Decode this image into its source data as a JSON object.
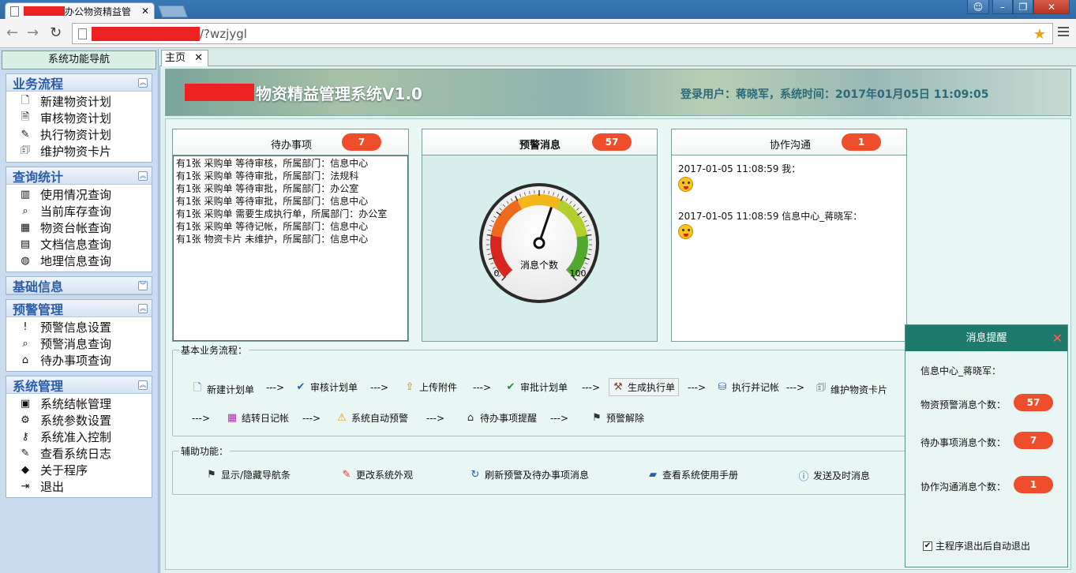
{
  "browser": {
    "tab_title": "办公物资精益管",
    "url_suffix": "/?wzjygl"
  },
  "sidebar": {
    "header": "系统功能导航",
    "sections": [
      {
        "title": "业务流程",
        "toggle": "︽",
        "items": [
          {
            "label": "新建物资计划",
            "icon": "🗋"
          },
          {
            "label": "审核物资计划",
            "icon": "🗎"
          },
          {
            "label": "执行物资计划",
            "icon": "✎"
          },
          {
            "label": "维护物资卡片",
            "icon": "🗊"
          }
        ]
      },
      {
        "title": "查询统计",
        "toggle": "︽",
        "items": [
          {
            "label": "使用情况查询",
            "icon": "▥"
          },
          {
            "label": "当前库存查询",
            "icon": "⌕"
          },
          {
            "label": "物资台帐查询",
            "icon": "▦"
          },
          {
            "label": "文档信息查询",
            "icon": "▤"
          },
          {
            "label": "地理信息查询",
            "icon": "◍"
          }
        ]
      },
      {
        "title": "基础信息",
        "toggle": "︾",
        "items": []
      },
      {
        "title": "预警管理",
        "toggle": "︽",
        "items": [
          {
            "label": "预警信息设置",
            "icon": "!"
          },
          {
            "label": "预警消息查询",
            "icon": "⌕"
          },
          {
            "label": "待办事项查询",
            "icon": "⌂"
          }
        ]
      },
      {
        "title": "系统管理",
        "toggle": "︽",
        "items": [
          {
            "label": "系统结帐管理",
            "icon": "▣"
          },
          {
            "label": "系统参数设置",
            "icon": "⚙"
          },
          {
            "label": "系统准入控制",
            "icon": "⚷"
          },
          {
            "label": "查看系统日志",
            "icon": "✎"
          },
          {
            "label": "关于程序",
            "icon": "◆"
          },
          {
            "label": "退出",
            "icon": "⇥"
          }
        ]
      }
    ]
  },
  "tabs": {
    "home": "主页",
    "close": "✕"
  },
  "banner": {
    "title": "物资精益管理系统V1.0",
    "user_info": "登录用户：蒋晓军，系统时间：2017年01月05日 11:09:05"
  },
  "panels": {
    "todo": {
      "title": "待办事项",
      "badge": "7",
      "lines": [
        "有1张 采购单 等待审核，所属部门：信息中心",
        "有1张 采购单 等待审批，所属部门：法规科",
        "有1张 采购单 等待审批，所属部门：办公室",
        "有1张 采购单 等待审批，所属部门：信息中心",
        "有1张 采购单 需要生成执行单，所属部门：办公室",
        "有1张 采购单 等待记帐，所属部门：信息中心",
        "有1张 物资卡片 未维护，所属部门：信息中心"
      ]
    },
    "alert": {
      "title": "预警消息",
      "badge": "57",
      "gauge": {
        "label": "消息个数",
        "min": "0",
        "max": "100",
        "value": 57
      }
    },
    "chat": {
      "title": "协作沟通",
      "badge": "1",
      "messages": [
        {
          "header": "2017-01-05 11:08:59 我："
        },
        {
          "header": "2017-01-05 11:08:59 信息中心_蒋晓军："
        }
      ]
    }
  },
  "flow": {
    "legend": "基本业务流程：",
    "arrow": "--->",
    "steps": [
      {
        "label": "新建计划单",
        "icon": "🗋",
        "color": "#4a6fa5"
      },
      {
        "label": "审核计划单",
        "icon": "✔",
        "color": "#2a5fb0"
      },
      {
        "label": "上传附件",
        "icon": "⇪",
        "color": "#c08a1a"
      },
      {
        "label": "审批计划单",
        "icon": "✔",
        "color": "#1f8a3a"
      },
      {
        "label": "生成执行单",
        "icon": "⚒",
        "color": "#7a4a2a"
      },
      {
        "label": "执行并记帐",
        "icon": "⛁",
        "color": "#3a6aa8"
      },
      {
        "label": "维护物资卡片",
        "icon": "🗊",
        "color": "#345"
      },
      {
        "label": "结转日记帐",
        "icon": "▦",
        "color": "#a3a"
      },
      {
        "label": "系统自动预警",
        "icon": "⚠",
        "color": "#e0a000"
      },
      {
        "label": "待办事项提醒",
        "icon": "⌂",
        "color": "#333"
      },
      {
        "label": "预警解除",
        "icon": "⚑",
        "color": "#333"
      }
    ]
  },
  "aux": {
    "legend": "辅助功能：",
    "items": [
      {
        "label": "显示/隐藏导航条",
        "icon": "⚑",
        "color": "#333"
      },
      {
        "label": "更改系统外观",
        "icon": "✎",
        "color": "#d03a2a"
      },
      {
        "label": "刷新预警及待办事项消息",
        "icon": "↻",
        "color": "#2a5fb0"
      },
      {
        "label": "查看系统使用手册",
        "icon": "▰",
        "color": "#2a5fb0"
      },
      {
        "label": "发送及时消息",
        "icon": "ⓘ",
        "color": "#2a5fb0"
      }
    ]
  },
  "popup": {
    "title": "消息提醒",
    "close": "✕",
    "user": "信息中心_蒋晓军：",
    "rows": [
      {
        "label": "物资预警消息个数：",
        "value": "57"
      },
      {
        "label": "待办事项消息个数：",
        "value": "7"
      },
      {
        "label": "协作沟通消息个数：",
        "value": "1"
      }
    ],
    "checkbox": {
      "label": "主程序退出后自动退出",
      "checked": true
    }
  }
}
